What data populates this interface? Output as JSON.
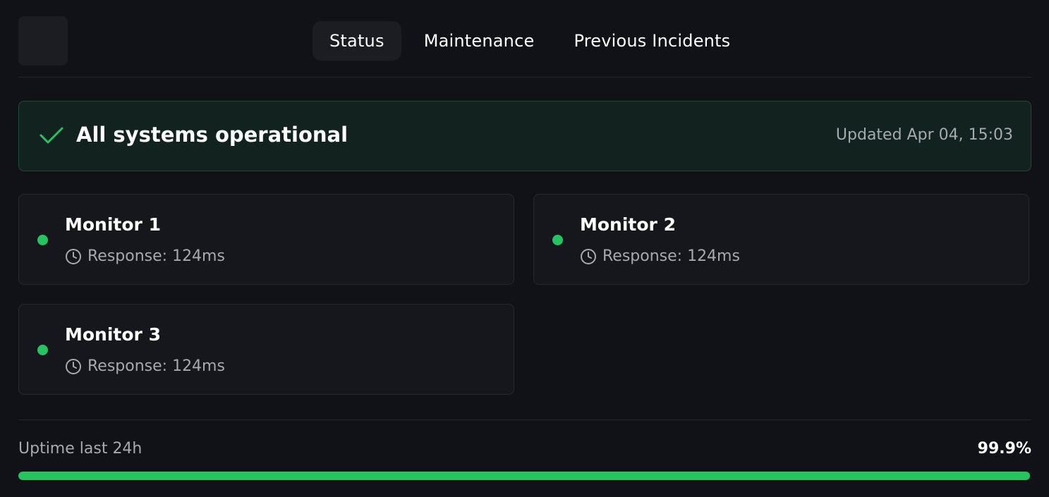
{
  "nav": {
    "tabs": [
      {
        "label": "Status",
        "active": true
      },
      {
        "label": "Maintenance",
        "active": false
      },
      {
        "label": "Previous Incidents",
        "active": false
      }
    ]
  },
  "banner": {
    "icon": "check-icon",
    "title": "All systems operational",
    "updated": "Updated Apr 04, 15:03"
  },
  "monitors": [
    {
      "name": "Monitor 1",
      "response": "Response: 124ms",
      "status_color": "#22c55e"
    },
    {
      "name": "Monitor 2",
      "response": "Response: 124ms",
      "status_color": "#22c55e"
    },
    {
      "name": "Monitor 3",
      "response": "Response: 124ms",
      "status_color": "#22c55e"
    }
  ],
  "uptime": {
    "label": "Uptime last 24h",
    "value": "99.9%",
    "percent": 99.9,
    "bar_color": "#22c55e"
  },
  "colors": {
    "background": "#111217",
    "accent_green": "#22c55e",
    "banner_background": "#12221f",
    "muted_text": "#a7a9ae"
  }
}
